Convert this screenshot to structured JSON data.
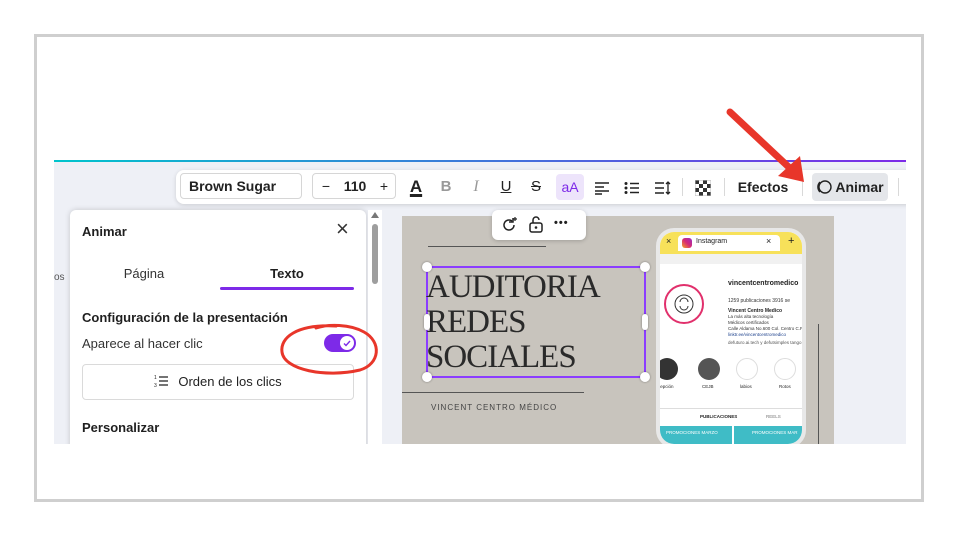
{
  "toolbar": {
    "font_name": "Brown Sugar",
    "size_minus": "−",
    "font_size": "110",
    "size_plus": "+",
    "text_color_label": "A",
    "bold_label": "B",
    "italic_label": "I",
    "underline_label": "U",
    "strike_label": "S",
    "case_label": "aA",
    "effects_label": "Efectos",
    "animate_label": "Animar"
  },
  "panel": {
    "title": "Animar",
    "close_label": "×",
    "tabs": [
      {
        "label": "Página"
      },
      {
        "label": "Texto"
      }
    ],
    "section_title": "Configuración de la presentación",
    "toggle_label": "Aparece al hacer clic",
    "toggle_on": true,
    "order_button_label": "Orden de los clics",
    "personalize_title": "Personalizar",
    "side_text": "os"
  },
  "canvas": {
    "headline_lines": [
      "AUDITORIA",
      "REDES",
      "SOCIALES"
    ],
    "subtitle": "VINCENT CENTRO MÉDICO",
    "ctx_more_label": "•••"
  },
  "phone": {
    "tab_title": "Instagram",
    "username": "vincentcentromedico",
    "stats": "1259 publicaciones  3916 se",
    "bio_name": "Vincent Centro Medico",
    "bio_lines": [
      "La más alta tecnología",
      "Médicos certificados",
      "Calle Aldama No.600 Col. Centro C.P.",
      "linktr.ee/vincentcentromedico"
    ],
    "follow_line": "defuturo.ai.tech y defutsimples tango",
    "highlights": [
      "cepción",
      "CEJB",
      "labios",
      "Rotos"
    ],
    "tabs_label": "PUBLICACIONES",
    "reels_label": "REELS",
    "banner_left": "PROMOCIONES MARZO",
    "banner_right": "PROMOCIONES MAR"
  },
  "colors": {
    "accent": "#7d2ae8",
    "annotation": "#e8362a",
    "canvas_bg": "#c8c4bd"
  }
}
